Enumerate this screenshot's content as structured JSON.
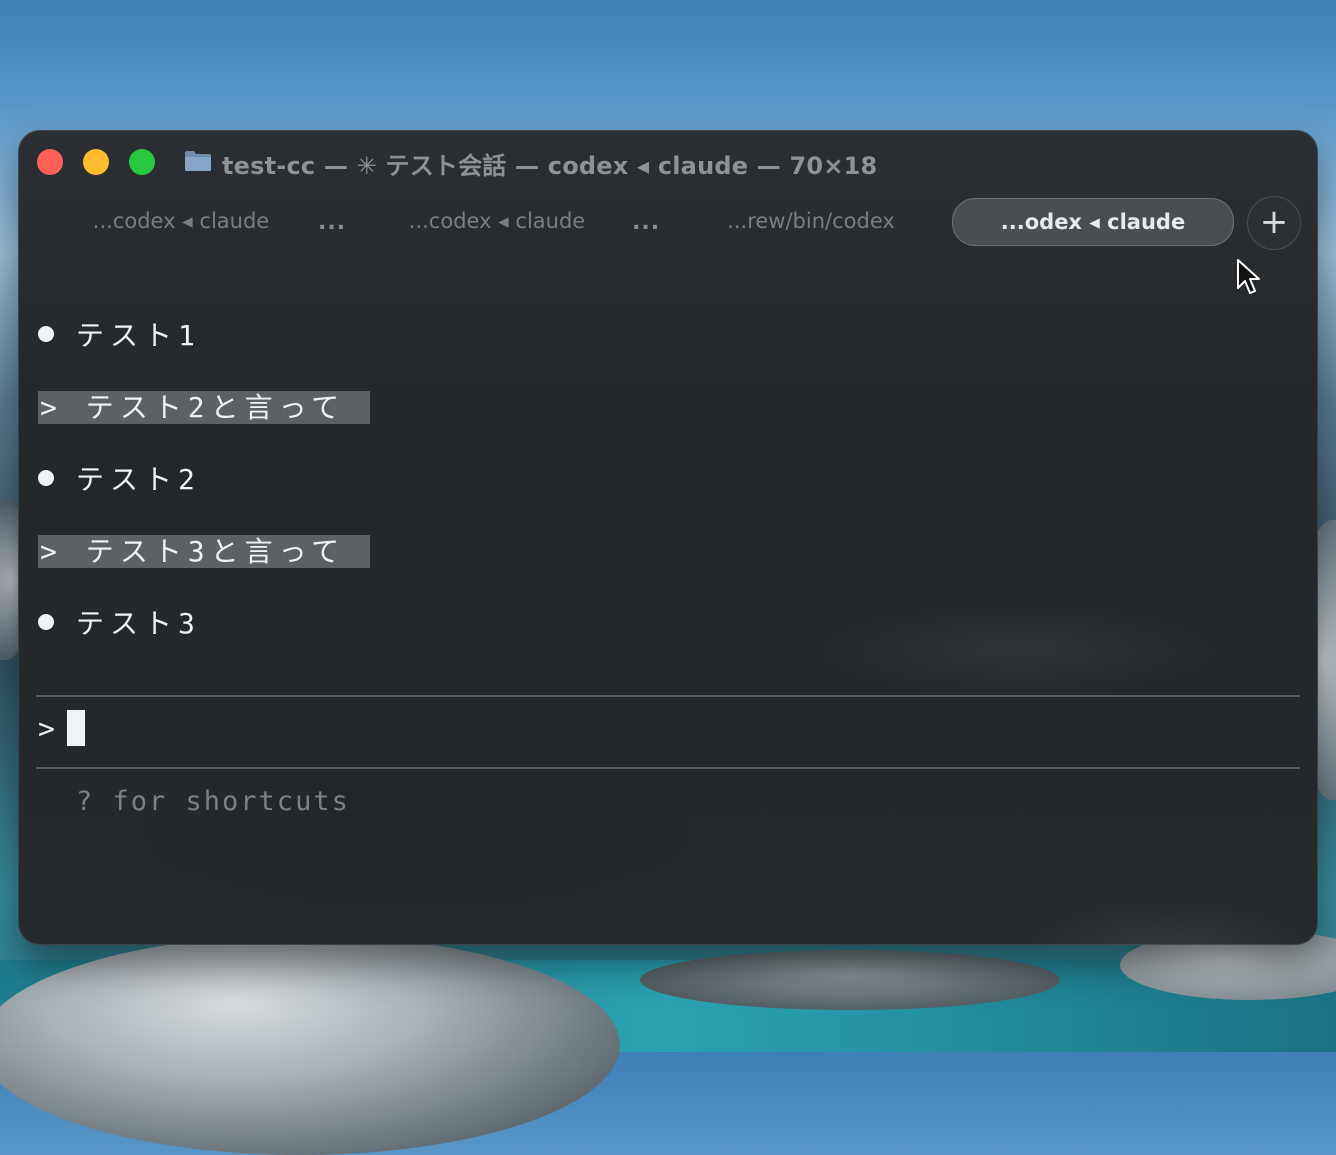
{
  "window": {
    "title": "test-cc — ✳ テスト会話 — codex ◂ claude — 70×18"
  },
  "tabs": [
    {
      "label": "...codex ◂ claude",
      "active": false
    },
    {
      "label": "...codex ◂ claude",
      "active": false
    },
    {
      "label": "...rew/bin/codex",
      "active": false
    },
    {
      "label": "...odex ◂ claude",
      "active": true
    }
  ],
  "tab_overflow": "...",
  "new_tab_label": "+",
  "transcript": [
    {
      "kind": "response",
      "text": "テスト1"
    },
    {
      "kind": "prompt",
      "prefix": ">",
      "text": "テスト2と言って"
    },
    {
      "kind": "response",
      "text": "テスト2"
    },
    {
      "kind": "prompt",
      "prefix": ">",
      "text": "テスト3と言って"
    },
    {
      "kind": "response",
      "text": "テスト3"
    }
  ],
  "input": {
    "prefix": ">",
    "value": ""
  },
  "hint": "? for shortcuts",
  "colors": {
    "accent_red": "#fe5f57",
    "accent_yellow": "#febc2e",
    "accent_green": "#28c840"
  }
}
